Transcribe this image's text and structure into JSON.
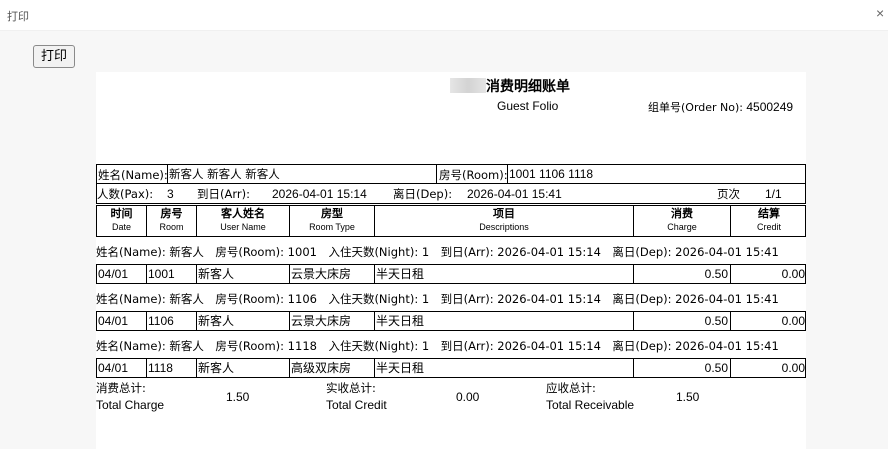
{
  "window": {
    "title": "打印",
    "close_icon": "×"
  },
  "toolbar": {
    "print_label": "打印"
  },
  "folio": {
    "title": "消费明细账单",
    "subtitle": "Guest Folio",
    "order_no_label": "组单号(Order No):",
    "order_no": "4500249",
    "name_label": "姓名(Name):",
    "name_value": "新客人 新客人 新客人",
    "room_label": "房号(Room):",
    "room_value": "1001 1106 1118",
    "pax_label": "人数(Pax):",
    "pax_value": "3",
    "arr_label": "到日(Arr):",
    "arr_value": "2026-04-01 15:14",
    "dep_label": "离日(Dep):",
    "dep_value": "2026-04-01 15:41",
    "page_label": "页次",
    "page_value": "1/1"
  },
  "columns": [
    {
      "cn": "时间",
      "en": "Date"
    },
    {
      "cn": "房号",
      "en": "Room"
    },
    {
      "cn": "客人姓名",
      "en": "User Name"
    },
    {
      "cn": "房型",
      "en": "Room Type"
    },
    {
      "cn": "项目",
      "en": "Descriptions"
    },
    {
      "cn": "消费",
      "en": "Charge"
    },
    {
      "cn": "结算",
      "en": "Credit"
    }
  ],
  "groups": [
    {
      "header": "姓名(Name): 新客人　房号(Room): 1001　入住天数(Night): 1　到日(Arr): 2026-04-01 15:14　离日(Dep): 2026-04-01 15:41",
      "row": {
        "date": "04/01",
        "room": "1001",
        "name": "新客人",
        "type": "云景大床房",
        "desc": "半天日租",
        "charge": "0.50",
        "credit": "0.00"
      }
    },
    {
      "header": "姓名(Name): 新客人　房号(Room): 1106　入住天数(Night): 1　到日(Arr): 2026-04-01 15:14　离日(Dep): 2026-04-01 15:41",
      "row": {
        "date": "04/01",
        "room": "1106",
        "name": "新客人",
        "type": "云景大床房",
        "desc": "半天日租",
        "charge": "0.50",
        "credit": "0.00"
      }
    },
    {
      "header": "姓名(Name): 新客人　房号(Room): 1118　入住天数(Night): 1　到日(Arr): 2026-04-01 15:14　离日(Dep): 2026-04-01 15:41",
      "row": {
        "date": "04/01",
        "room": "1118",
        "name": "新客人",
        "type": "高级双床房",
        "desc": "半天日租",
        "charge": "0.50",
        "credit": "0.00"
      }
    }
  ],
  "totals": {
    "charge_cn": "消费总计:",
    "charge_en": "Total Charge",
    "charge_value": "1.50",
    "credit_cn": "实收总计:",
    "credit_en": "Total Credit",
    "credit_value": "0.00",
    "receivable_cn": "应收总计:",
    "receivable_en": "Total Receivable",
    "receivable_value": "1.50"
  }
}
